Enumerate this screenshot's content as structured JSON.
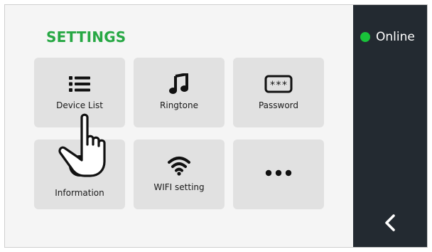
{
  "header": {
    "title": "SETTINGS"
  },
  "status": {
    "label": "Online",
    "color": "#19c23a"
  },
  "tiles": [
    {
      "label": "Device List",
      "icon": "list-icon"
    },
    {
      "label": "Ringtone",
      "icon": "music-note-icon"
    },
    {
      "label": "Password",
      "icon": "password-icon"
    },
    {
      "label": "Information",
      "icon": "info-icon"
    },
    {
      "label": "WIFI setting",
      "icon": "wifi-icon"
    },
    {
      "label": "",
      "icon": "more-icon"
    }
  ],
  "navigation": {
    "back_icon": "chevron-left-icon"
  },
  "colors": {
    "accent": "#27a844",
    "sidebar": "#232a31",
    "tile": "#e1e1e1"
  }
}
